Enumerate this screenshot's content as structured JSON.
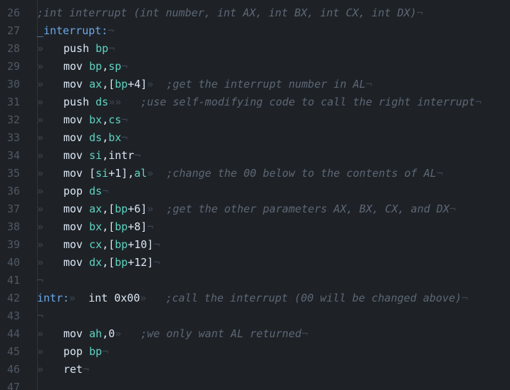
{
  "editor": {
    "lines": [
      {
        "n": "26",
        "parts": [
          {
            "c": "cmt",
            "t": ";int interrupt (int number, int AX, int BX, int CX, int DX)"
          },
          {
            "c": "ws",
            "t": "¬"
          }
        ]
      },
      {
        "n": "27",
        "parts": [
          {
            "c": "lbl",
            "t": "_interrupt:"
          },
          {
            "c": "ws",
            "t": "¬"
          }
        ]
      },
      {
        "n": "28",
        "parts": [
          {
            "c": "ind",
            "t": "»"
          },
          {
            "c": "kw",
            "t": "push "
          },
          {
            "c": "reg",
            "t": "bp"
          },
          {
            "c": "ws",
            "t": "¬"
          }
        ]
      },
      {
        "n": "29",
        "parts": [
          {
            "c": "ind",
            "t": "»"
          },
          {
            "c": "kw",
            "t": "mov "
          },
          {
            "c": "reg",
            "t": "bp"
          },
          {
            "c": "pun",
            "t": ","
          },
          {
            "c": "reg",
            "t": "sp"
          },
          {
            "c": "ws",
            "t": "¬"
          }
        ]
      },
      {
        "n": "30",
        "parts": [
          {
            "c": "ind",
            "t": "»"
          },
          {
            "c": "kw",
            "t": "mov "
          },
          {
            "c": "reg",
            "t": "ax"
          },
          {
            "c": "pun",
            "t": ",["
          },
          {
            "c": "reg",
            "t": "bp"
          },
          {
            "c": "num",
            "t": "+4]"
          },
          {
            "c": "ws",
            "t": "»  "
          },
          {
            "c": "cmt",
            "t": ";get the interrupt number in AL"
          },
          {
            "c": "ws",
            "t": "¬"
          }
        ]
      },
      {
        "n": "31",
        "parts": [
          {
            "c": "ind",
            "t": "»"
          },
          {
            "c": "kw",
            "t": "push "
          },
          {
            "c": "reg",
            "t": "ds"
          },
          {
            "c": "ws",
            "t": "»»   "
          },
          {
            "c": "cmt",
            "t": ";use self-modifying code to call the right interrupt"
          },
          {
            "c": "ws",
            "t": "¬"
          }
        ]
      },
      {
        "n": "32",
        "parts": [
          {
            "c": "ind",
            "t": "»"
          },
          {
            "c": "kw",
            "t": "mov "
          },
          {
            "c": "reg",
            "t": "bx"
          },
          {
            "c": "pun",
            "t": ","
          },
          {
            "c": "reg",
            "t": "cs"
          },
          {
            "c": "ws",
            "t": "¬"
          }
        ]
      },
      {
        "n": "33",
        "parts": [
          {
            "c": "ind",
            "t": "»"
          },
          {
            "c": "kw",
            "t": "mov "
          },
          {
            "c": "reg",
            "t": "ds"
          },
          {
            "c": "pun",
            "t": ","
          },
          {
            "c": "reg",
            "t": "bx"
          },
          {
            "c": "ws",
            "t": "¬"
          }
        ]
      },
      {
        "n": "34",
        "parts": [
          {
            "c": "ind",
            "t": "»"
          },
          {
            "c": "kw",
            "t": "mov "
          },
          {
            "c": "reg",
            "t": "si"
          },
          {
            "c": "pun",
            "t": ",intr"
          },
          {
            "c": "ws",
            "t": "¬"
          }
        ]
      },
      {
        "n": "35",
        "parts": [
          {
            "c": "ind",
            "t": "»"
          },
          {
            "c": "kw",
            "t": "mov "
          },
          {
            "c": "pun",
            "t": "["
          },
          {
            "c": "reg",
            "t": "si"
          },
          {
            "c": "num",
            "t": "+1],"
          },
          {
            "c": "reg",
            "t": "al"
          },
          {
            "c": "ws",
            "t": "»  "
          },
          {
            "c": "cmt",
            "t": ";change the 00 below to the contents of AL"
          },
          {
            "c": "ws",
            "t": "¬"
          }
        ]
      },
      {
        "n": "36",
        "parts": [
          {
            "c": "ind",
            "t": "»"
          },
          {
            "c": "kw",
            "t": "pop "
          },
          {
            "c": "reg",
            "t": "ds"
          },
          {
            "c": "ws",
            "t": "¬"
          }
        ]
      },
      {
        "n": "37",
        "parts": [
          {
            "c": "ind",
            "t": "»"
          },
          {
            "c": "kw",
            "t": "mov "
          },
          {
            "c": "reg",
            "t": "ax"
          },
          {
            "c": "pun",
            "t": ",["
          },
          {
            "c": "reg",
            "t": "bp"
          },
          {
            "c": "num",
            "t": "+6]"
          },
          {
            "c": "ws",
            "t": "»  "
          },
          {
            "c": "cmt",
            "t": ";get the other parameters AX, BX, CX, and DX"
          },
          {
            "c": "ws",
            "t": "¬"
          }
        ]
      },
      {
        "n": "38",
        "parts": [
          {
            "c": "ind",
            "t": "»"
          },
          {
            "c": "kw",
            "t": "mov "
          },
          {
            "c": "reg",
            "t": "bx"
          },
          {
            "c": "pun",
            "t": ",["
          },
          {
            "c": "reg",
            "t": "bp"
          },
          {
            "c": "num",
            "t": "+8]"
          },
          {
            "c": "ws",
            "t": "¬"
          }
        ]
      },
      {
        "n": "39",
        "parts": [
          {
            "c": "ind",
            "t": "»"
          },
          {
            "c": "kw",
            "t": "mov "
          },
          {
            "c": "reg",
            "t": "cx"
          },
          {
            "c": "pun",
            "t": ",["
          },
          {
            "c": "reg",
            "t": "bp"
          },
          {
            "c": "num",
            "t": "+10]"
          },
          {
            "c": "ws",
            "t": "¬"
          }
        ]
      },
      {
        "n": "40",
        "parts": [
          {
            "c": "ind",
            "t": "»"
          },
          {
            "c": "kw",
            "t": "mov "
          },
          {
            "c": "reg",
            "t": "dx"
          },
          {
            "c": "pun",
            "t": ",["
          },
          {
            "c": "reg",
            "t": "bp"
          },
          {
            "c": "num",
            "t": "+12]"
          },
          {
            "c": "ws",
            "t": "¬"
          }
        ]
      },
      {
        "n": "41",
        "parts": [
          {
            "c": "ws",
            "t": "¬"
          }
        ]
      },
      {
        "n": "42",
        "parts": [
          {
            "c": "lbl",
            "t": "intr:"
          },
          {
            "c": "ws",
            "t": "»  "
          },
          {
            "c": "kw",
            "t": "int 0x00"
          },
          {
            "c": "ws",
            "t": "»   "
          },
          {
            "c": "cmt",
            "t": ";call the interrupt (00 will be changed above)"
          },
          {
            "c": "ws",
            "t": "¬"
          }
        ]
      },
      {
        "n": "43",
        "parts": [
          {
            "c": "ws",
            "t": "¬"
          }
        ]
      },
      {
        "n": "44",
        "parts": [
          {
            "c": "ind",
            "t": "»"
          },
          {
            "c": "kw",
            "t": "mov "
          },
          {
            "c": "reg",
            "t": "ah"
          },
          {
            "c": "pun",
            "t": ",0"
          },
          {
            "c": "ws",
            "t": "»   "
          },
          {
            "c": "cmt",
            "t": ";we only want AL returned"
          },
          {
            "c": "ws",
            "t": "¬"
          }
        ]
      },
      {
        "n": "45",
        "parts": [
          {
            "c": "ind",
            "t": "»"
          },
          {
            "c": "kw",
            "t": "pop "
          },
          {
            "c": "reg",
            "t": "bp"
          },
          {
            "c": "ws",
            "t": "¬"
          }
        ]
      },
      {
        "n": "46",
        "parts": [
          {
            "c": "ind",
            "t": "»"
          },
          {
            "c": "kw",
            "t": "ret"
          },
          {
            "c": "ws",
            "t": "¬"
          }
        ]
      },
      {
        "n": "47",
        "parts": []
      }
    ]
  },
  "colors": {
    "background": "#1e2227",
    "line_number": "#4f5863",
    "text": "#dbe6f2",
    "register": "#5fd4c2",
    "label": "#6aa7e8",
    "comment": "#5d6774",
    "whitespace_marker": "#3e4550"
  }
}
